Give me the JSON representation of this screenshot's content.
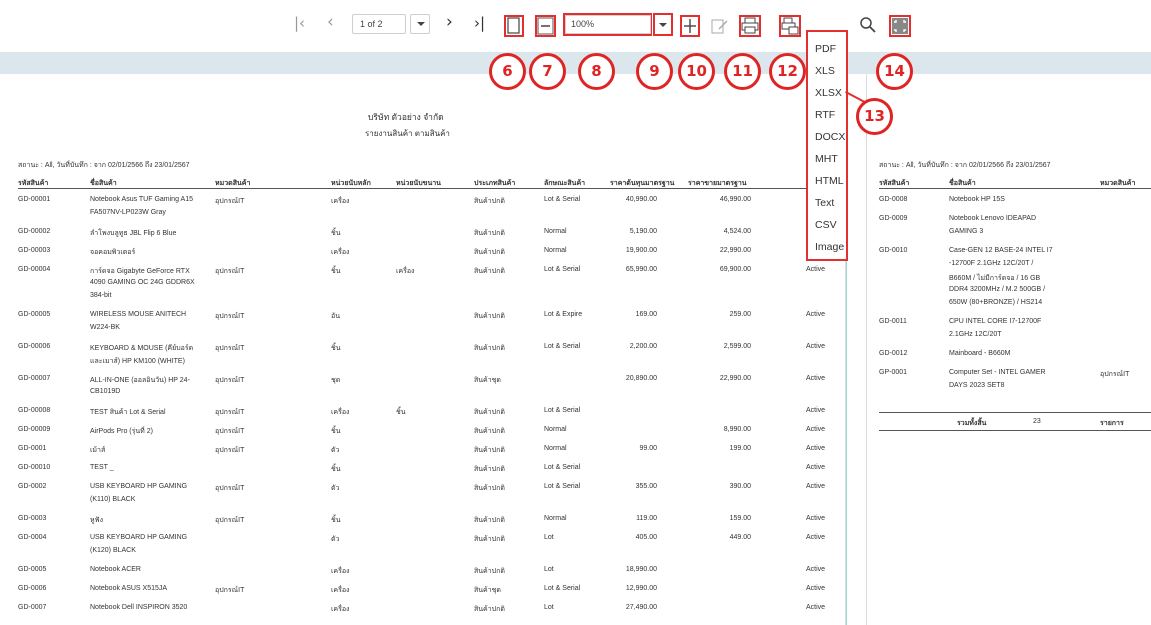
{
  "toolbar": {
    "first_icon": "first-page-icon",
    "prev_icon": "previous-page-icon",
    "page_value": "1 of 2",
    "next_icon": "next-page-icon",
    "last_icon": "last-page-icon",
    "zoom_value": "100%",
    "buttons": [
      "single-page-icon",
      "zoom-out-icon",
      "zoom-select",
      "zoom-dropdown-icon",
      "zoom-in-icon",
      "edit-icon",
      "print-icon",
      "export-icon",
      "search-icon",
      "fullscreen-icon"
    ]
  },
  "callouts": [
    "6",
    "7",
    "8",
    "9",
    "10",
    "11",
    "12",
    "13",
    "14"
  ],
  "accent_color": "#e23030",
  "export_menu": [
    "PDF",
    "XLS",
    "XLSX",
    "RTF",
    "DOCX",
    "MHT",
    "HTML",
    "Text",
    "CSV",
    "Image"
  ],
  "report": {
    "company": "บริษัท ตัวอย่าง จำกัด",
    "title": "รายงานสินค้า ตามสินค้า",
    "filter": "สถานะ : All, วันที่บันทึก : จาก 02/01/2566 ถึง 23/01/2567",
    "columns": [
      "รหัสสินค้า",
      "ชื่อสินค้า",
      "หมวดสินค้า",
      "หน่วยนับหลัก",
      "หน่วยนับขนาน",
      "ประเภทสินค้า",
      "ลักษณะสินค้า",
      "ราคาต้นทุนมาตรฐาน",
      "ราคาขายมาตรฐาน"
    ],
    "rows": [
      {
        "code": "GD-00001",
        "name": [
          "Notebook Asus TUF Gaming A15",
          "FA507NV-LP023W Gray"
        ],
        "cat": "อุปกรณ์IT",
        "unit": "เครื่อง",
        "unit2": "",
        "type": "สินค้าปกติ",
        "nature": "Lot & Serial",
        "cost": "40,990.00",
        "price": "46,990.00",
        "status": ""
      },
      {
        "code": "GD-00002",
        "name": [
          "ลำโพงบลูทูธ JBL Flip 6 Blue"
        ],
        "cat": "",
        "unit": "ชิ้น",
        "unit2": "",
        "type": "สินค้าปกติ",
        "nature": "Normal",
        "cost": "5,190.00",
        "price": "4,524.00",
        "status": ""
      },
      {
        "code": "GD-00003",
        "name": [
          "จอคอมพิวเตอร์"
        ],
        "cat": "",
        "unit": "เครื่อง",
        "unit2": "",
        "type": "สินค้าปกติ",
        "nature": "Normal",
        "cost": "19,900.00",
        "price": "22,990.00",
        "status": ""
      },
      {
        "code": "GD-00004",
        "name": [
          "การ์ดจอ Gigabyte GeForce RTX",
          "4090 GAMING OC 24G GDDR6X",
          "384-bit"
        ],
        "cat": "อุปกรณ์IT",
        "unit": "ชิ้น",
        "unit2": "เครื่อง",
        "type": "สินค้าปกติ",
        "nature": "Lot & Serial",
        "cost": "65,990.00",
        "price": "69,900.00",
        "status": "Active"
      },
      {
        "code": "GD-00005",
        "name": [
          "WIRELESS MOUSE ANITECH",
          "W224-BK"
        ],
        "cat": "อุปกรณ์IT",
        "unit": "อัน",
        "unit2": "",
        "type": "สินค้าปกติ",
        "nature": "Lot & Expire",
        "cost": "169.00",
        "price": "259.00",
        "status": "Active"
      },
      {
        "code": "GD-00006",
        "name": [
          "KEYBOARD & MOUSE (คีย์บอร์ด",
          "และเมาส์) HP KM100 (WHITE)"
        ],
        "cat": "อุปกรณ์IT",
        "unit": "ชิ้น",
        "unit2": "",
        "type": "สินค้าปกติ",
        "nature": "Lot & Serial",
        "cost": "2,200.00",
        "price": "2,599.00",
        "status": "Active"
      },
      {
        "code": "GD-00007",
        "name": [
          "ALL-IN-ONE (ออลอินวัน) HP 24-",
          "CB1019D"
        ],
        "cat": "อุปกรณ์IT",
        "unit": "ชุด",
        "unit2": "",
        "type": "สินค้าชุด",
        "nature": "",
        "cost": "20,890.00",
        "price": "22,990.00",
        "status": "Active"
      },
      {
        "code": "GD-00008",
        "name": [
          "TEST สินค้า Lot & Serial"
        ],
        "cat": "อุปกรณ์IT",
        "unit": "เครื่อง",
        "unit2": "ชิ้น",
        "type": "สินค้าปกติ",
        "nature": "Lot & Serial",
        "cost": "",
        "price": "",
        "status": "Active"
      },
      {
        "code": "GD-00009",
        "name": [
          "AirPods Pro (รุ่นที่ 2)"
        ],
        "cat": "อุปกรณ์IT",
        "unit": "ชิ้น",
        "unit2": "",
        "type": "สินค้าปกติ",
        "nature": "Normal",
        "cost": "",
        "price": "8,990.00",
        "status": "Active"
      },
      {
        "code": "GD-0001",
        "name": [
          "เม้าส์"
        ],
        "cat": "อุปกรณ์IT",
        "unit": "ตัว",
        "unit2": "",
        "type": "สินค้าปกติ",
        "nature": "Normal",
        "cost": "99.00",
        "price": "199.00",
        "status": "Active"
      },
      {
        "code": "GD-00010",
        "name": [
          "TEST _"
        ],
        "cat": "",
        "unit": "ชิ้น",
        "unit2": "",
        "type": "สินค้าปกติ",
        "nature": "Lot & Serial",
        "cost": "",
        "price": "",
        "status": "Active"
      },
      {
        "code": "GD-0002",
        "name": [
          "USB KEYBOARD HP GAMING",
          "(K110) BLACK"
        ],
        "cat": "อุปกรณ์IT",
        "unit": "ตัว",
        "unit2": "",
        "type": "สินค้าปกติ",
        "nature": "Lot & Serial",
        "cost": "355.00",
        "price": "390.00",
        "status": "Active"
      },
      {
        "code": "GD-0003",
        "name": [
          "หูฟัง"
        ],
        "cat": "อุปกรณ์IT",
        "unit": "ชิ้น",
        "unit2": "",
        "type": "สินค้าปกติ",
        "nature": "Normal",
        "cost": "119.00",
        "price": "159.00",
        "status": "Active"
      },
      {
        "code": "GD-0004",
        "name": [
          "USB KEYBOARD HP GAMING",
          "(K120) BLACK"
        ],
        "cat": "",
        "unit": "ตัว",
        "unit2": "",
        "type": "สินค้าปกติ",
        "nature": "Lot",
        "cost": "405.00",
        "price": "449.00",
        "status": "Active"
      },
      {
        "code": "GD-0005",
        "name": [
          "Notebook ACER"
        ],
        "cat": "",
        "unit": "เครื่อง",
        "unit2": "",
        "type": "สินค้าปกติ",
        "nature": "Lot",
        "cost": "18,990.00",
        "price": "",
        "status": "Active"
      },
      {
        "code": "GD-0006",
        "name": [
          "Notebook ASUS X515JA"
        ],
        "cat": "อุปกรณ์IT",
        "unit": "เครื่อง",
        "unit2": "",
        "type": "สินค้าชุด",
        "nature": "Lot & Serial",
        "cost": "12,990.00",
        "price": "",
        "status": "Active"
      },
      {
        "code": "GD-0007",
        "name": [
          "Notebook Dell INSPIRON 3520"
        ],
        "cat": "",
        "unit": "เครื่อง",
        "unit2": "",
        "type": "สินค้าปกติ",
        "nature": "Lot",
        "cost": "27,490.00",
        "price": "",
        "status": "Active"
      }
    ]
  },
  "page2": {
    "filter": "สถานะ : All, วันที่บันทึก : จาก 02/01/2566 ถึง 23/01/2567",
    "columns": [
      "รหัสสินค้า",
      "ชื่อสินค้า",
      "หมวดสินค้า"
    ],
    "rows": [
      {
        "code": "GD-0008",
        "name": [
          "Notebook HP 15S"
        ],
        "cat": ""
      },
      {
        "code": "GD-0009",
        "name": [
          "Notebook Lenovo IDEAPAD",
          "GAMING 3"
        ],
        "cat": ""
      },
      {
        "code": "GD-0010",
        "name": [
          "Case-GEN 12 BASE-24 INTEL I7",
          "-12700F 2.1GHz 12C/20T /",
          "B660M / ไม่มีการ์ดจอ / 16 GB",
          "DDR4 3200MHz / M.2 500GB /",
          "650W (80+BRONZE) / HS214"
        ],
        "cat": ""
      },
      {
        "code": "GD-0011",
        "name": [
          "CPU INTEL CORE I7-12700F",
          "2.1GHz 12C/20T"
        ],
        "cat": ""
      },
      {
        "code": "GD-0012",
        "name": [
          "Mainboard - B660M"
        ],
        "cat": ""
      },
      {
        "code": "GP-0001",
        "name": [
          "Computer Set - INTEL GAMER",
          "DAYS 2023 SET8"
        ],
        "cat": "อุปกรณ์IT"
      }
    ],
    "total_label": "รวมทั้งสิ้น",
    "total_count": "23",
    "total_unit": "รายการ"
  }
}
